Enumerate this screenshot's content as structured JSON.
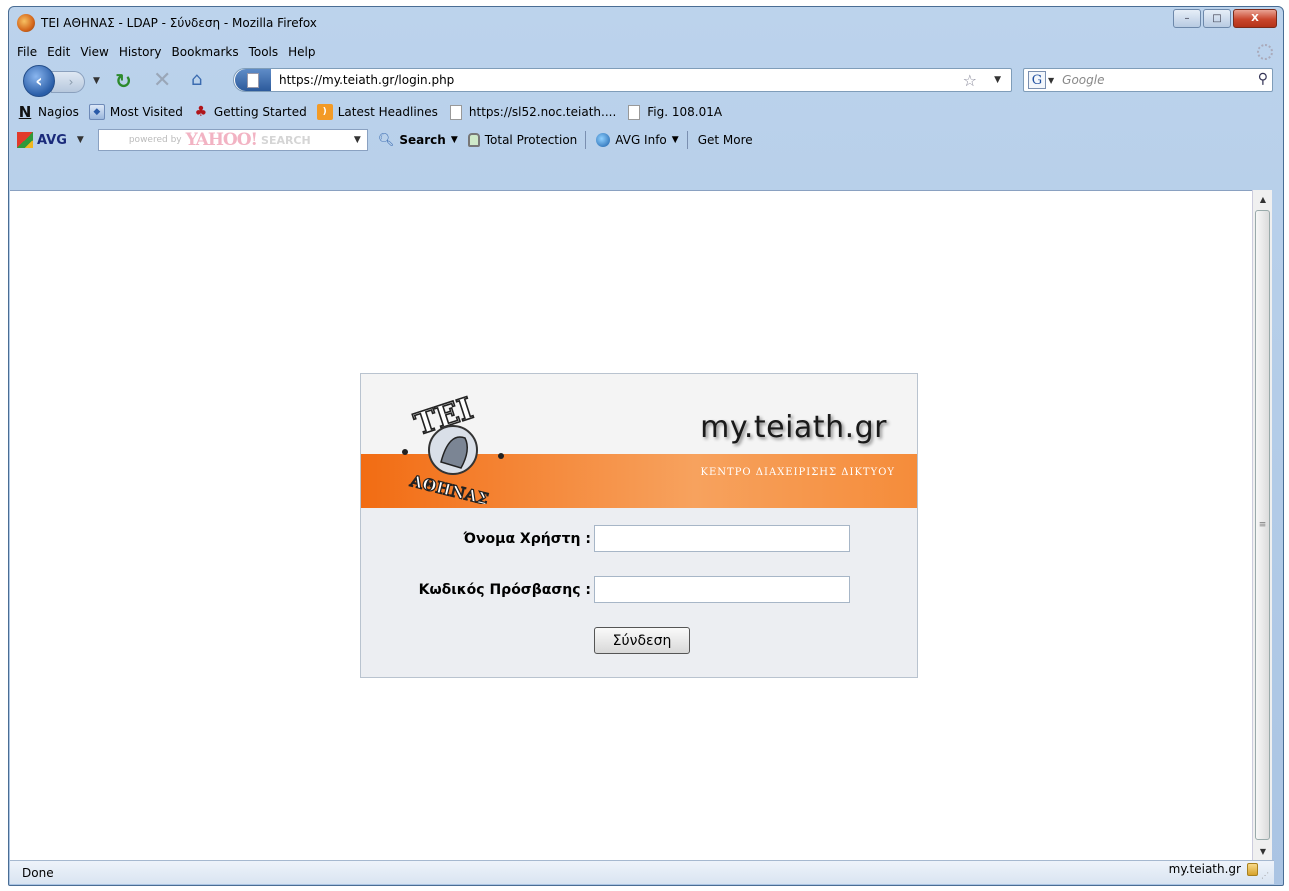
{
  "window": {
    "title": "ΤΕΙ ΑΘΗΝΑΣ - LDAP - Σύνδεση - Mozilla Firefox",
    "controls": {
      "minimize": "–",
      "maximize": "□",
      "close": "X"
    }
  },
  "menu": [
    "File",
    "Edit",
    "View",
    "History",
    "Bookmarks",
    "Tools",
    "Help"
  ],
  "nav": {
    "url": "https://my.teiath.gr/login.php",
    "search_placeholder": "Google"
  },
  "bookmarks": [
    {
      "label": "Nagios",
      "icon": "nagios-icon"
    },
    {
      "label": "Most Visited",
      "icon": "most-visited-icon"
    },
    {
      "label": "Getting Started",
      "icon": "getting-started-icon"
    },
    {
      "label": "Latest Headlines",
      "icon": "rss-icon"
    },
    {
      "label": "https://sl52.noc.teiath....",
      "icon": "page-icon"
    },
    {
      "label": "Fig. 108.01A",
      "icon": "page-icon"
    }
  ],
  "avg_toolbar": {
    "brand": "AVG",
    "powered_by": "powered by",
    "yahoo": "YAHOO!",
    "yahoo_search": "SEARCH",
    "search": "Search",
    "total_protection": "Total Protection",
    "avg_info": "AVG Info",
    "get_more": "Get More"
  },
  "login": {
    "site_title": "my.teiath.gr",
    "subtitle": "ΚΕΝΤΡΟ ΔΙΑΧΕΙΡΙΣΗΣ ΔΙΚΤΥΟΥ",
    "logo_top": "ΤΕΙ",
    "logo_bottom": "ΑΘΗΝΑΣ",
    "username_label": "Όνομα Χρήστη :",
    "username_value": "",
    "password_label": "Κωδικός Πρόσβασης :",
    "password_value": "",
    "submit_label": "Σύνδεση"
  },
  "status": {
    "left": "Done",
    "right": "my.teiath.gr"
  },
  "colors": {
    "banner_orange": "#f26c13",
    "window_frame": "#bcd3ec"
  }
}
